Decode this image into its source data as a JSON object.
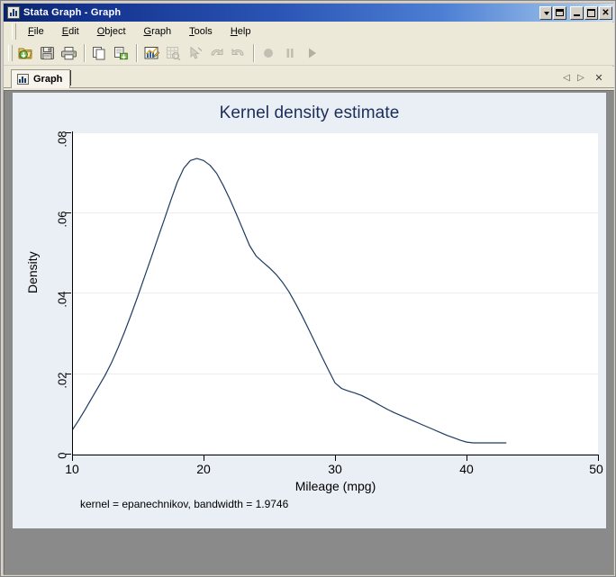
{
  "window": {
    "title": "Stata Graph - Graph",
    "icon": "bar-chart-icon",
    "controls": [
      {
        "name": "window-menu-dropdown",
        "glyph": "caret-down-icon"
      },
      {
        "name": "restore-down-button",
        "glyph": "restore-icon"
      },
      {
        "name": "minimize-button",
        "glyph": "minimize-icon"
      },
      {
        "name": "maximize-button",
        "glyph": "maximize-icon"
      },
      {
        "name": "close-button",
        "glyph": "close-icon",
        "label": "✕"
      }
    ]
  },
  "menubar": {
    "items": [
      {
        "label": "File",
        "accel": "F"
      },
      {
        "label": "Edit",
        "accel": "E"
      },
      {
        "label": "Object",
        "accel": "O"
      },
      {
        "label": "Graph",
        "accel": "G"
      },
      {
        "label": "Tools",
        "accel": "T"
      },
      {
        "label": "Help",
        "accel": "H"
      }
    ]
  },
  "toolbar": {
    "buttons": [
      {
        "name": "open-graph-button",
        "icon": "folder-open-icon",
        "enabled": true
      },
      {
        "name": "save-graph-button",
        "icon": "save-floppy-icon",
        "enabled": true
      },
      {
        "name": "print-graph-button",
        "icon": "printer-icon",
        "enabled": true
      },
      {
        "name": "copy-button",
        "icon": "copy-pages-icon",
        "enabled": true
      },
      {
        "name": "save-as-button",
        "icon": "export-document-icon",
        "enabled": true
      },
      {
        "name": "start-graph-editor-button",
        "icon": "graph-editor-icon",
        "enabled": true
      },
      {
        "name": "grid-edit-button",
        "icon": "grid-preview-icon",
        "enabled": false
      },
      {
        "name": "pointer-tool-button",
        "icon": "pointer-arrow-icon",
        "enabled": false
      },
      {
        "name": "undo-button",
        "icon": "undo-arrow-icon",
        "enabled": false
      },
      {
        "name": "redo-button",
        "icon": "redo-arrow-icon",
        "enabled": false
      },
      {
        "name": "record-button",
        "icon": "record-circle-icon",
        "enabled": false
      },
      {
        "name": "pause-button",
        "icon": "pause-bars-icon",
        "enabled": false
      },
      {
        "name": "play-button",
        "icon": "play-triangle-icon",
        "enabled": false
      }
    ]
  },
  "tabstrip": {
    "tabs": [
      {
        "label": "Graph",
        "icon": "bar-chart-icon",
        "active": true
      }
    ],
    "nav": {
      "prev": "◁",
      "next": "▷",
      "close": "✕"
    }
  },
  "chart_data": {
    "type": "line",
    "title": "Kernel density estimate",
    "xlabel": "Mileage (mpg)",
    "ylabel": "Density",
    "note": "kernel = epanechnikov, bandwidth = 1.9746",
    "xlim": [
      10,
      50
    ],
    "ylim": [
      0,
      0.08
    ],
    "xticks": [
      10,
      20,
      30,
      40,
      50
    ],
    "xtick_labels": [
      "10",
      "20",
      "30",
      "40",
      "50"
    ],
    "yticks": [
      0,
      0.02,
      0.04,
      0.06,
      0.08
    ],
    "ytick_labels": [
      "0",
      ".02",
      ".04",
      ".06",
      ".08"
    ],
    "grid": "horizontal",
    "legend": "none",
    "line_color": "#1f3b61",
    "plot_background": "#ffffff",
    "canvas_background": "#eaeff5",
    "series": [
      {
        "name": "Density",
        "x": [
          10.0,
          10.5,
          11.0,
          11.5,
          12.0,
          12.5,
          13.0,
          13.5,
          14.0,
          14.5,
          15.0,
          15.5,
          16.0,
          16.5,
          17.0,
          17.5,
          18.0,
          18.5,
          19.0,
          19.5,
          20.0,
          20.5,
          21.0,
          21.5,
          22.0,
          22.5,
          23.0,
          23.5,
          24.0,
          24.5,
          25.0,
          25.5,
          26.0,
          26.5,
          27.0,
          27.5,
          28.0,
          28.5,
          29.0,
          29.5,
          30.0,
          30.5,
          31.0,
          31.5,
          32.0,
          32.5,
          33.0,
          33.5,
          34.0,
          34.5,
          35.0,
          35.5,
          36.0,
          36.5,
          37.0,
          37.5,
          38.0,
          38.5,
          39.0,
          39.5,
          40.0,
          40.5,
          41.0,
          41.5,
          42.0,
          42.5,
          43.0
        ],
        "y": [
          0.006,
          0.0085,
          0.0112,
          0.014,
          0.0168,
          0.0196,
          0.0228,
          0.0265,
          0.0305,
          0.0348,
          0.0393,
          0.044,
          0.0487,
          0.0535,
          0.0582,
          0.063,
          0.0676,
          0.0711,
          0.073,
          0.0735,
          0.073,
          0.0718,
          0.0698,
          0.0668,
          0.0634,
          0.0597,
          0.0558,
          0.0519,
          0.0493,
          0.0478,
          0.0464,
          0.0448,
          0.0428,
          0.0404,
          0.0375,
          0.0344,
          0.0311,
          0.0277,
          0.0243,
          0.021,
          0.0178,
          0.0164,
          0.0158,
          0.0153,
          0.0147,
          0.0139,
          0.013,
          0.0121,
          0.0112,
          0.0104,
          0.0097,
          0.009,
          0.0083,
          0.0076,
          0.0069,
          0.0062,
          0.0055,
          0.0048,
          0.0042,
          0.0036,
          0.0031,
          0.0029,
          0.0029,
          0.0029,
          0.0029,
          0.0029,
          0.0029
        ]
      }
    ]
  }
}
